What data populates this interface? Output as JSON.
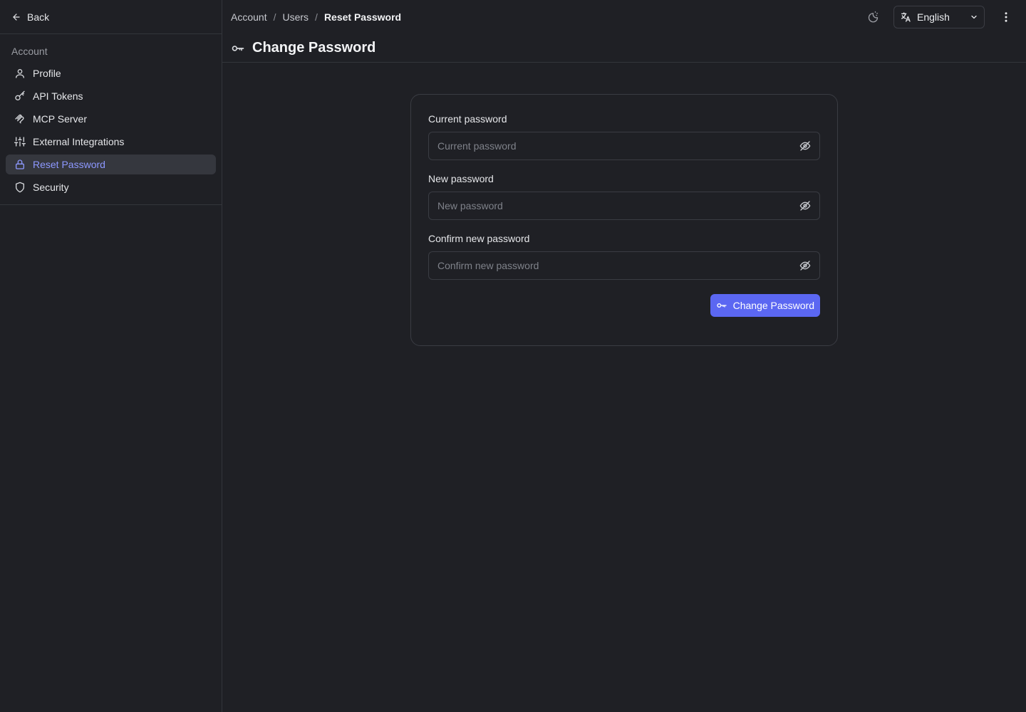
{
  "sidebar": {
    "back_label": "Back",
    "section_heading": "Account",
    "items": [
      {
        "label": "Profile",
        "icon": "user-icon"
      },
      {
        "label": "API Tokens",
        "icon": "key-icon"
      },
      {
        "label": "MCP Server",
        "icon": "mcp-icon"
      },
      {
        "label": "External Integrations",
        "icon": "sliders-icon"
      },
      {
        "label": "Reset Password",
        "icon": "lock-icon",
        "active": true
      },
      {
        "label": "Security",
        "icon": "shield-icon"
      }
    ]
  },
  "header": {
    "breadcrumb": [
      "Account",
      "Users",
      "Reset Password"
    ],
    "breadcrumb_separator": "/",
    "language": "English",
    "title": "Change Password"
  },
  "form": {
    "fields": [
      {
        "label": "Current password",
        "placeholder": "Current password"
      },
      {
        "label": "New password",
        "placeholder": "New password"
      },
      {
        "label": "Confirm new password",
        "placeholder": "Confirm new password"
      }
    ],
    "submit_label": "Change Password"
  },
  "colors": {
    "background": "#1f2025",
    "accent": "#5b67f2",
    "active_text": "#8d98ff",
    "border": "#3a3c43"
  }
}
